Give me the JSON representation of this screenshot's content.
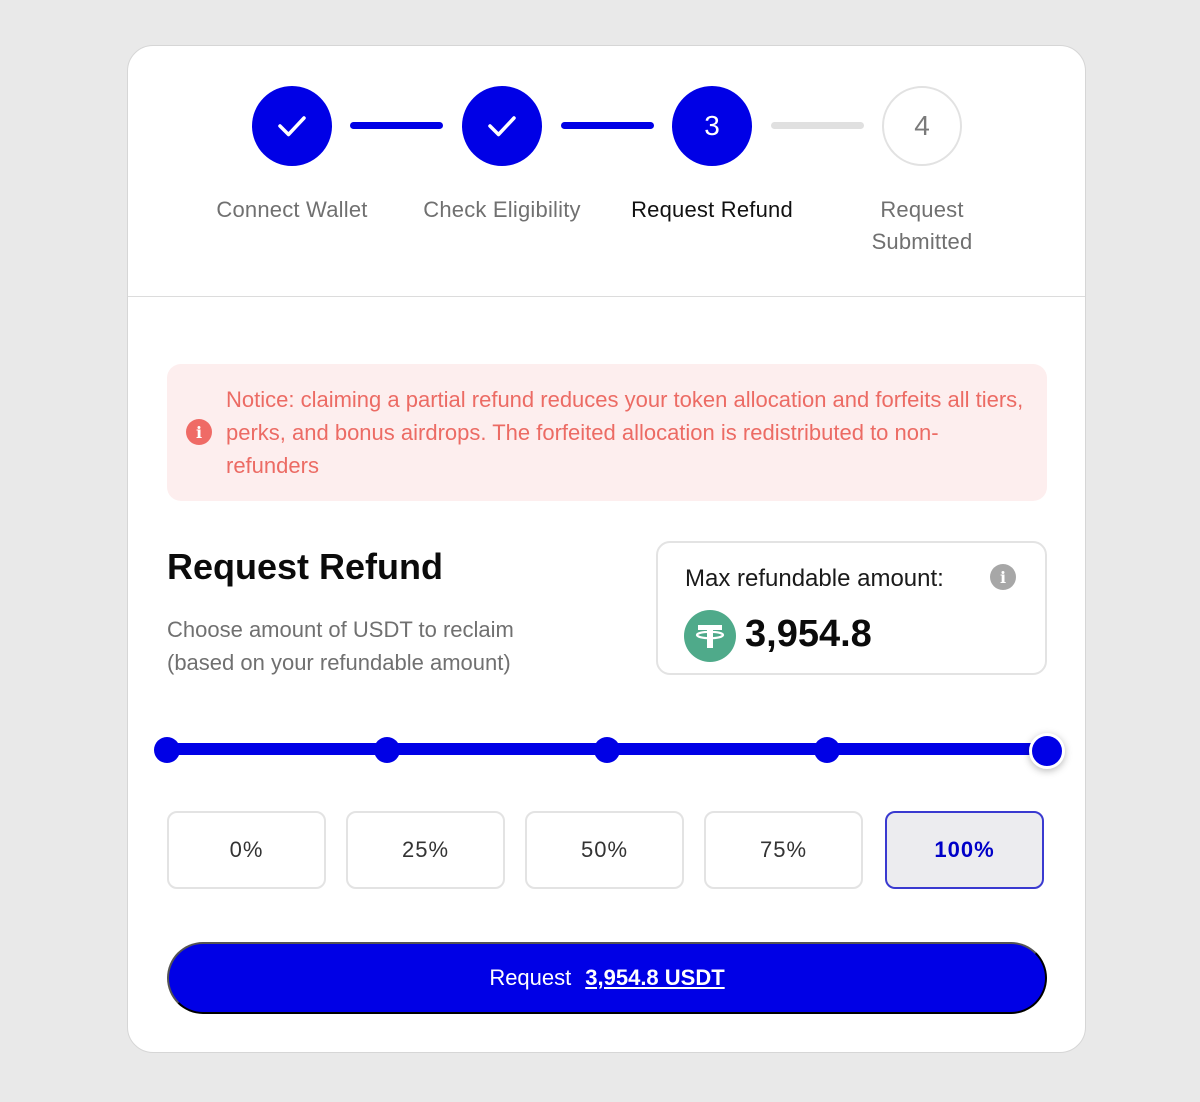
{
  "stepper": {
    "steps": [
      {
        "label": "Connect Wallet",
        "state": "done",
        "icon": "check-icon"
      },
      {
        "label": "Check Eligibility",
        "state": "done",
        "icon": "check-icon"
      },
      {
        "label": "Request Refund",
        "state": "active",
        "number": "3"
      },
      {
        "label_line1": "Request",
        "label_line2": "Submitted",
        "state": "todo",
        "number": "4"
      }
    ]
  },
  "notice": {
    "icon": "info-icon",
    "text": "Notice: claiming a partial refund reduces your token allocation and forfeits all tiers, perks, and bonus airdrops. The forfeited allocation is redistributed to non-refunders"
  },
  "refund": {
    "title": "Request Refund",
    "subtitle_line1": "Choose amount of USDT to reclaim",
    "subtitle_line2": "(based on your refundable amount)"
  },
  "max_box": {
    "label": "Max refundable amount:",
    "info_icon": "info-icon",
    "token_icon": "usdt-icon",
    "value": "3,954.8"
  },
  "slider": {
    "value_percent": 100,
    "stops_percent": [
      0,
      25,
      50,
      75,
      100
    ]
  },
  "percent_buttons": [
    {
      "label": "0%",
      "selected": false
    },
    {
      "label": "25%",
      "selected": false
    },
    {
      "label": "50%",
      "selected": false
    },
    {
      "label": "75%",
      "selected": false
    },
    {
      "label": "100%",
      "selected": true
    }
  ],
  "request_button": {
    "label": "Request",
    "amount": "3,954.8 USDT"
  },
  "colors": {
    "accent": "#0000e6",
    "notice_bg": "#fdeeee",
    "notice_text": "#ec6b64",
    "usdt_green": "#4faa8a"
  }
}
